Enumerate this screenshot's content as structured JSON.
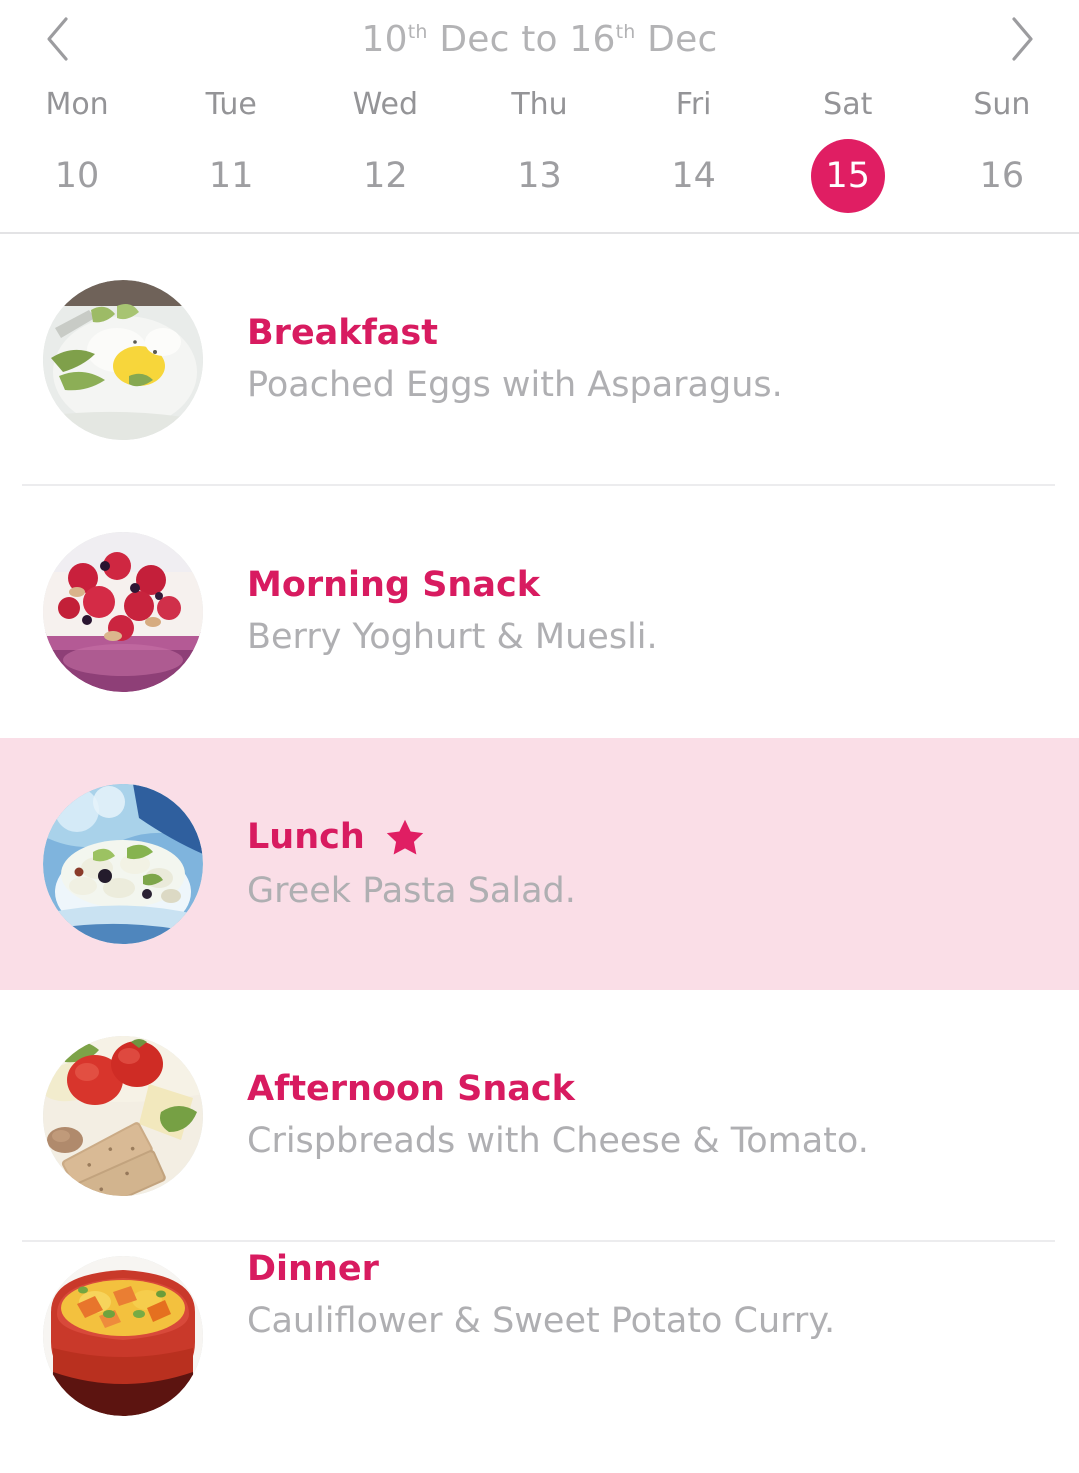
{
  "header": {
    "prev_label": "chevron-left",
    "next_label": "chevron-right",
    "title_start_day": "10",
    "title_start_suffix": "th",
    "title_mid": " Dec to ",
    "title_end_day": "16",
    "title_end_suffix": "th",
    "title_tail": " Dec",
    "title_full": "10th Dec to 16th Dec",
    "days": [
      {
        "label": "Mon",
        "date": "10",
        "selected": false
      },
      {
        "label": "Tue",
        "date": "11",
        "selected": false
      },
      {
        "label": "Wed",
        "date": "12",
        "selected": false
      },
      {
        "label": "Thu",
        "date": "13",
        "selected": false
      },
      {
        "label": "Fri",
        "date": "14",
        "selected": false
      },
      {
        "label": "Sat",
        "date": "15",
        "selected": true
      },
      {
        "label": "Sun",
        "date": "16",
        "selected": false
      }
    ]
  },
  "meals": [
    {
      "title": "Breakfast",
      "description": "Poached Eggs with Asparagus.",
      "image": "poached-eggs-asparagus-photo",
      "starred": false,
      "highlighted": false
    },
    {
      "title": "Morning Snack",
      "description": "Berry Yoghurt & Muesli.",
      "image": "berry-yoghurt-muesli-photo",
      "starred": false,
      "highlighted": false
    },
    {
      "title": "Lunch",
      "description": "Greek Pasta Salad.",
      "image": "greek-pasta-salad-photo",
      "starred": true,
      "highlighted": true
    },
    {
      "title": "Afternoon Snack",
      "description": "Crispbreads with Cheese & Tomato.",
      "image": "crispbreads-cheese-tomato-photo",
      "starred": false,
      "highlighted": false
    },
    {
      "title": "Dinner",
      "description": "Cauliflower & Sweet Potato Curry.",
      "image": "cauliflower-sweet-potato-curry-photo",
      "starred": false,
      "highlighted": false
    }
  ],
  "colors": {
    "accent": "#e01e63",
    "title_pink": "#d81b60",
    "highlight_row": "#fadee7",
    "muted_text": "#afafb2",
    "day_label": "#949497",
    "header_title": "#b3b3b5",
    "divider": "#ececee"
  }
}
